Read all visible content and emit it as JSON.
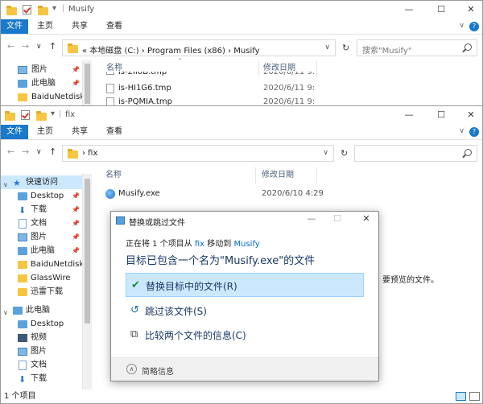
{
  "back_window": {
    "title": "Musify",
    "window_controls": [
      "—",
      "☐",
      "✕"
    ],
    "ribbon_tabs": [
      "文件",
      "主页",
      "共享",
      "查看"
    ],
    "nav_buttons": [
      "←",
      "→",
      "∨",
      "↑"
    ],
    "address": "« 本地磁盘 (C:) › Program Files (x86) › Musify",
    "address_dropdown": "∨",
    "refresh": "↻",
    "search_placeholder": "搜索\"Musify\"",
    "nav_items": [
      {
        "label": "图片",
        "pinned": true
      },
      {
        "label": "此电脑",
        "pinned": true
      },
      {
        "label": "BaiduNetdiskD",
        "pinned": false
      }
    ],
    "columns": {
      "name": "名称",
      "date": "修改日期"
    },
    "files": [
      {
        "name": "is-2II0B.tmp",
        "date": "2020/6/11 9:"
      },
      {
        "name": "is-HI1G6.tmp",
        "date": "2020/6/11 9:"
      },
      {
        "name": "is-PQMIA.tmp",
        "date": "2020/6/11 9:"
      }
    ]
  },
  "front_window": {
    "title": "fix",
    "window_controls": [
      "—",
      "☐",
      "✕"
    ],
    "ribbon_tabs": [
      "文件",
      "主页",
      "共享",
      "查看"
    ],
    "nav_buttons": [
      "←",
      "→",
      "∨",
      "↑"
    ],
    "address": "› fix",
    "address_dropdown": "∨",
    "refresh": "↻",
    "nav_items": [
      {
        "label": "快速访问",
        "icon": "star",
        "pinned": false,
        "selected": true
      },
      {
        "label": "Desktop",
        "icon": "pc",
        "pinned": true
      },
      {
        "label": "下载",
        "icon": "down",
        "pinned": true
      },
      {
        "label": "文档",
        "icon": "doc",
        "pinned": true
      },
      {
        "label": "图片",
        "icon": "pic",
        "pinned": true
      },
      {
        "label": "此电脑",
        "icon": "pc",
        "pinned": true
      },
      {
        "label": "BaiduNetdiskD",
        "icon": "folder",
        "pinned": false
      },
      {
        "label": "GlassWire",
        "icon": "folder",
        "pinned": false
      },
      {
        "label": "迅雷下载",
        "icon": "folder",
        "pinned": false
      },
      {
        "label": "此电脑",
        "icon": "pc",
        "pinned": false
      },
      {
        "label": "Desktop",
        "icon": "pc",
        "pinned": false
      },
      {
        "label": "视频",
        "icon": "video",
        "pinned": false
      },
      {
        "label": "图片",
        "icon": "pic",
        "pinned": false
      },
      {
        "label": "文档",
        "icon": "doc",
        "pinned": false
      },
      {
        "label": "下载",
        "icon": "down",
        "pinned": false
      }
    ],
    "columns": {
      "name": "名称",
      "date": "修改日期"
    },
    "files": [
      {
        "name": "Musify.exe",
        "date": "2020/6/10 4:29"
      }
    ],
    "preview_hint": "要预览的文件。",
    "status": "1 个项目"
  },
  "dialog": {
    "title": "替换或跳过文件",
    "line1_prefix": "正在将 1 个项目从 ",
    "line1_src": "fix",
    "line1_mid": " 移动到 ",
    "line1_dst": "Musify",
    "headline": "目标已包含一个名为\"Musify.exe\"的文件",
    "options": [
      {
        "label": "替换目标中的文件(R)",
        "icon": "✔",
        "selected": true
      },
      {
        "label": "跳过该文件(S)",
        "icon": "↺",
        "selected": false
      },
      {
        "label": "比较两个文件的信息(C)",
        "icon": "⧉",
        "selected": false
      }
    ],
    "more_label": "简略信息",
    "controls": [
      "—",
      "☐",
      "✕"
    ]
  },
  "colors": {
    "accent": "#1979ca",
    "selection": "#cce8ff"
  }
}
